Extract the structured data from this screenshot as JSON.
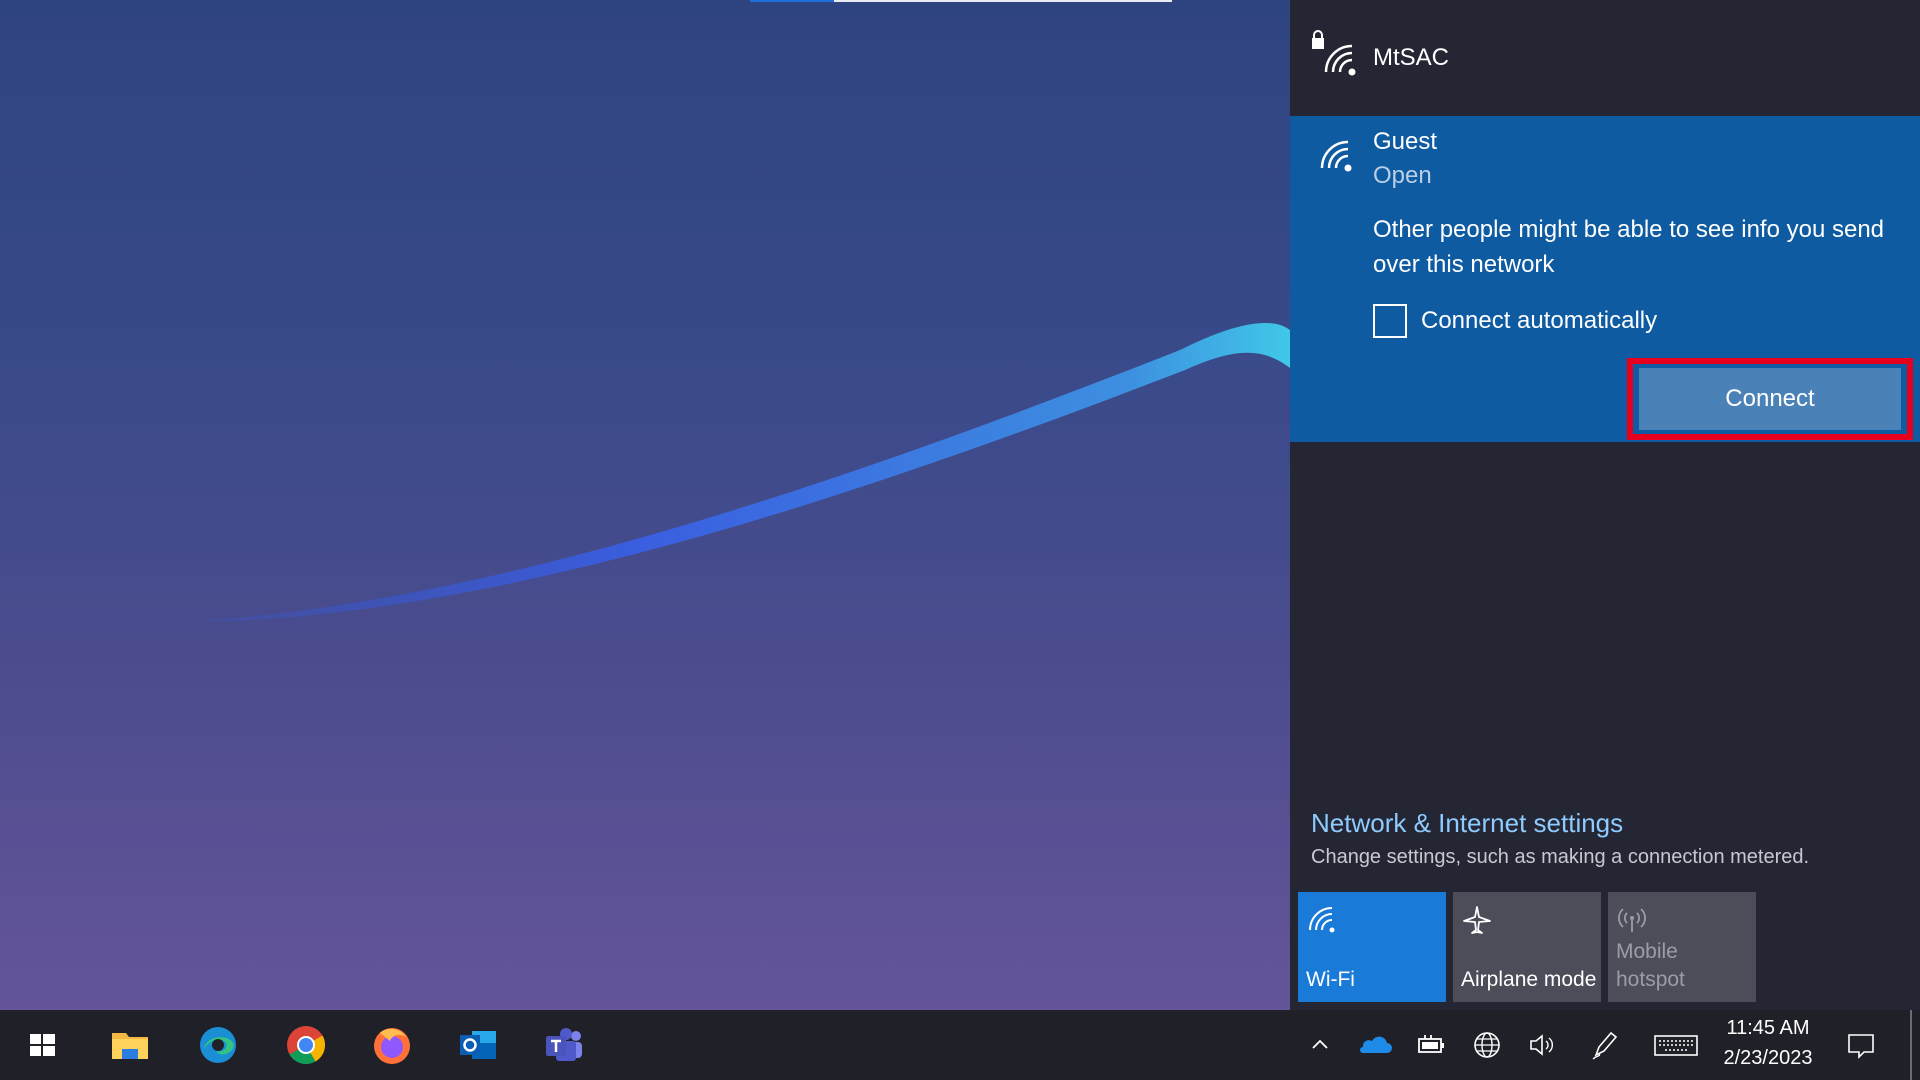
{
  "networks": {
    "mtsac": {
      "name": "MtSAC",
      "icon": "wifi-secured-icon"
    },
    "guest": {
      "name": "Guest",
      "status": "Open",
      "warning": "Other people might be able to see info you send over this network",
      "connect_auto_label": "Connect automatically",
      "connect_auto_checked": false,
      "connect_label": "Connect"
    }
  },
  "settings": {
    "link": "Network & Internet settings",
    "description": "Change settings, such as making a connection metered."
  },
  "quick_actions": [
    {
      "label": "Wi-Fi",
      "active": true,
      "icon": "wifi-icon"
    },
    {
      "label": "Airplane mode",
      "active": false,
      "icon": "airplane-icon"
    },
    {
      "label": "Mobile\nhotspot",
      "active": false,
      "disabled": true,
      "icon": "hotspot-icon"
    }
  ],
  "taskbar": {
    "apps": [
      "start-icon",
      "file-explorer-icon",
      "edge-icon",
      "chrome-icon",
      "firefox-icon",
      "outlook-icon",
      "teams-icon"
    ],
    "tray": [
      "show-hidden-icons-icon",
      "onedrive-icon",
      "battery-icon",
      "network-globe-icon",
      "volume-icon",
      "pen-icon",
      "touch-keyboard-icon"
    ],
    "time": "11:45 AM",
    "date": "2/23/2023"
  },
  "colors": {
    "accent": "#0e5ba2",
    "wifi_tile": "#1a7ad8",
    "highlight": "#e6001e",
    "link": "#8ecbff"
  }
}
